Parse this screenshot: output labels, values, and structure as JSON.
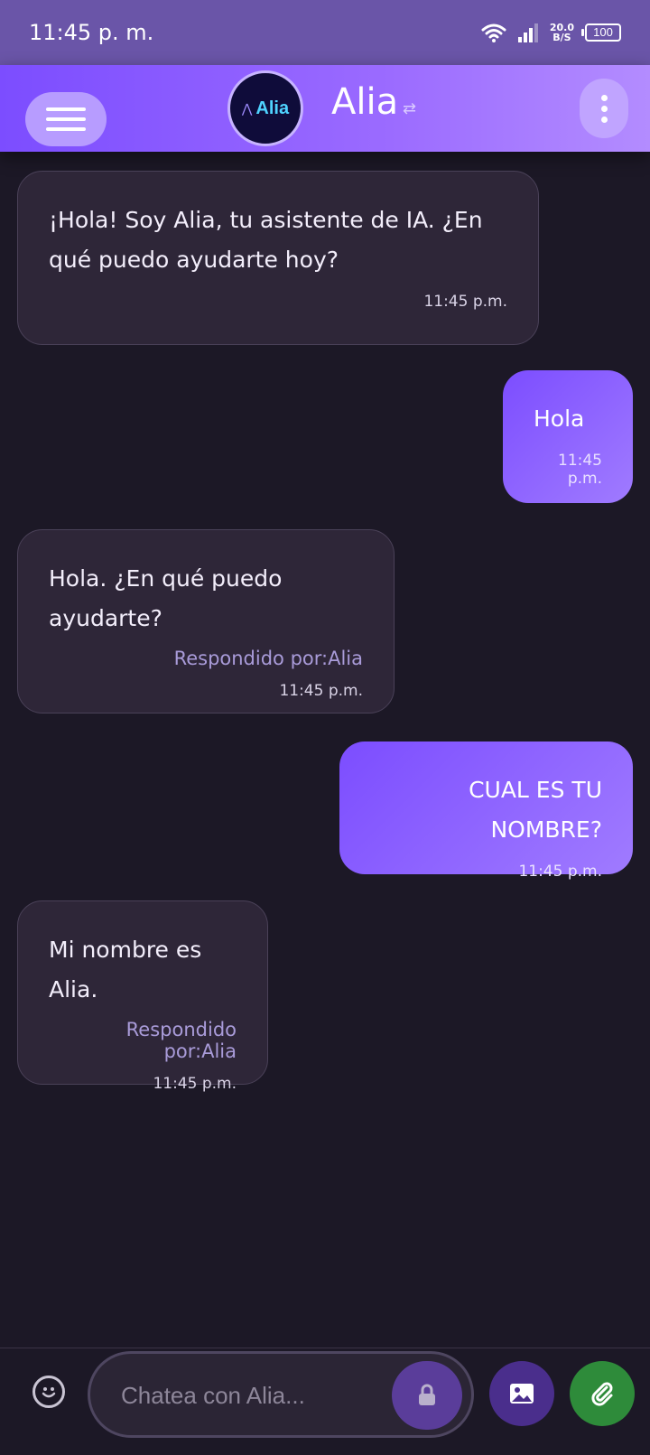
{
  "status_bar": {
    "time": "11:45 p. m.",
    "speed_value": "20.0",
    "speed_unit": "B/S",
    "battery": "100"
  },
  "header": {
    "title": "Alia",
    "logo_text": "Alia",
    "swap_glyph": "⇄"
  },
  "messages": [
    {
      "sender": "bot",
      "text": "¡Hola! Soy Alia, tu asistente de IA. ¿En qué puedo ayudarte hoy?",
      "credit": "",
      "time": "11:45 p.m."
    },
    {
      "sender": "user",
      "text": "Hola",
      "credit": "",
      "time": "11:45 p.m."
    },
    {
      "sender": "bot",
      "text": "Hola. ¿En qué puedo ayudarte?",
      "credit": "Respondido por:Alia",
      "time": "11:45 p.m."
    },
    {
      "sender": "user",
      "text": "CUAL ES TU NOMBRE?",
      "credit": "",
      "time": "11:45 p.m."
    },
    {
      "sender": "bot",
      "text": "Mi nombre es Alia.",
      "credit": "Respondido por:Alia",
      "time": "11:45 p.m."
    }
  ],
  "composer": {
    "placeholder": "Chatea con Alia...",
    "value": ""
  },
  "icons": {
    "menu": "hamburger-icon",
    "more": "more-vertical-icon",
    "emoji": "emoji-icon",
    "lock": "lock-icon",
    "image": "image-icon",
    "attach": "paperclip-icon"
  },
  "colors": {
    "accent": "#7c4dff",
    "background": "#1c1826",
    "bot_bubble": "#2e2638",
    "attach_button": "#2e8b3a"
  }
}
